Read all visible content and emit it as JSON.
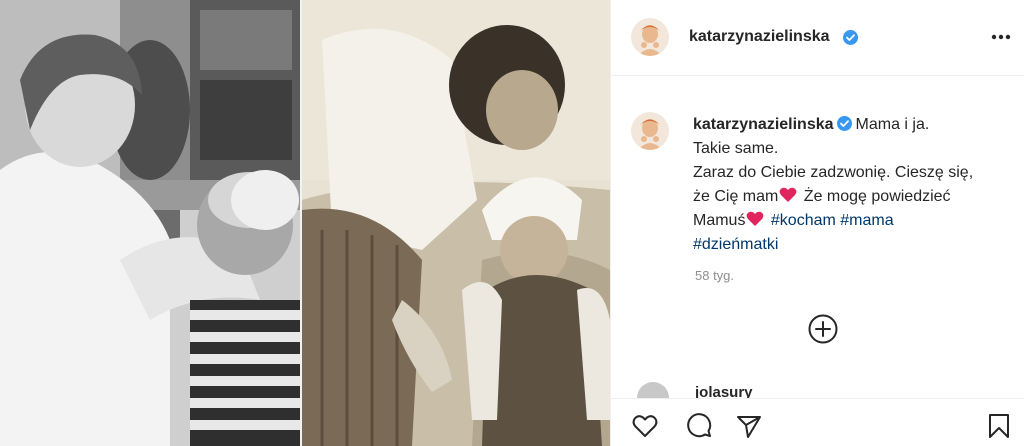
{
  "post": {
    "username": "katarzynazielinska",
    "caption_lines": [
      "Mama i ja.",
      "Takie same.",
      "Zaraz do Ciebie zadzwonię. Cieszę się,",
      "że Cię mam",
      " Że mogę powiedzieć",
      "Mamuś"
    ],
    "hashtags": [
      "#kocham",
      "#mama",
      "#dzieńmatki"
    ],
    "time_ago": "58 tyg.",
    "next_comment_user": "jolasury"
  },
  "icons": {
    "verified": "verified-badge-icon",
    "more": "more-options-icon",
    "load_more": "plus-circle-icon",
    "like": "heart-icon",
    "comment": "comment-icon",
    "share": "paper-plane-icon",
    "save": "bookmark-icon",
    "emoji": "red-heart-emoji"
  },
  "colors": {
    "verified": "#3897f0",
    "hashtag": "#00376b",
    "muted": "#8e8e8e",
    "heart_emoji": "#e0245e"
  }
}
